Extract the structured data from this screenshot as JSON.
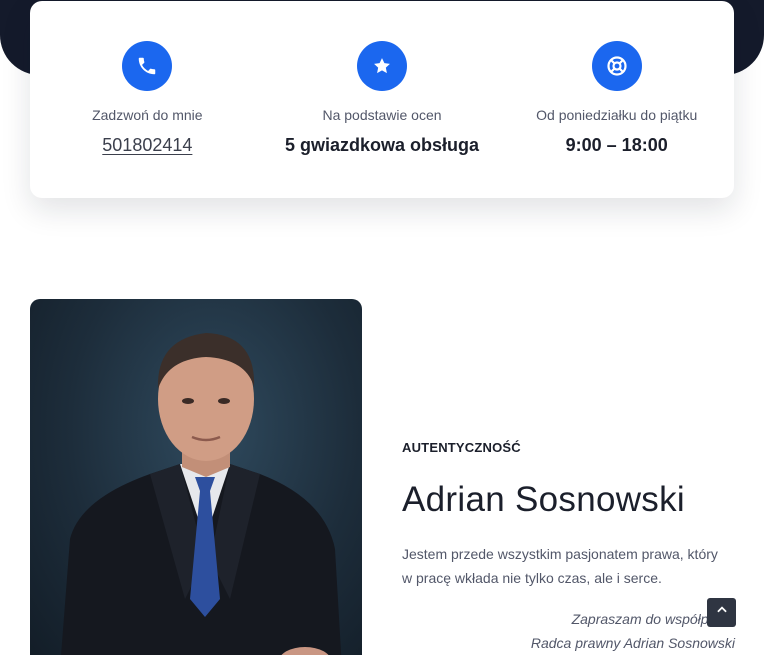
{
  "contact_card": {
    "phone": {
      "icon": "phone-icon",
      "label": "Zadzwoń do mnie",
      "value": "501802414"
    },
    "rating": {
      "icon": "star-icon",
      "label": "Na podstawie ocen",
      "value": "5 gwiazdkowa obsługa"
    },
    "hours": {
      "icon": "lifebuoy-icon",
      "label": "Od poniedziałku do piątku",
      "value": "9:00 – 18:00"
    }
  },
  "about": {
    "eyebrow": "AUTENTYCZNOŚĆ",
    "name": "Adrian Sosnowski",
    "description": "Jestem przede wszystkim pasjonatem prawa, który w pracę wkłada nie tylko czas, ale i serce.",
    "invite": "Zapraszam do współpracy",
    "signature": "Radca prawny Adrian Sosnowski",
    "photo_alt": "Adrian Sosnowski"
  },
  "scroll_top": {
    "icon": "chevron-up-icon"
  },
  "colors": {
    "accent": "#1b67ef",
    "dark_band": "#141a2b",
    "text": "#1b1f2b",
    "muted": "#525769"
  }
}
